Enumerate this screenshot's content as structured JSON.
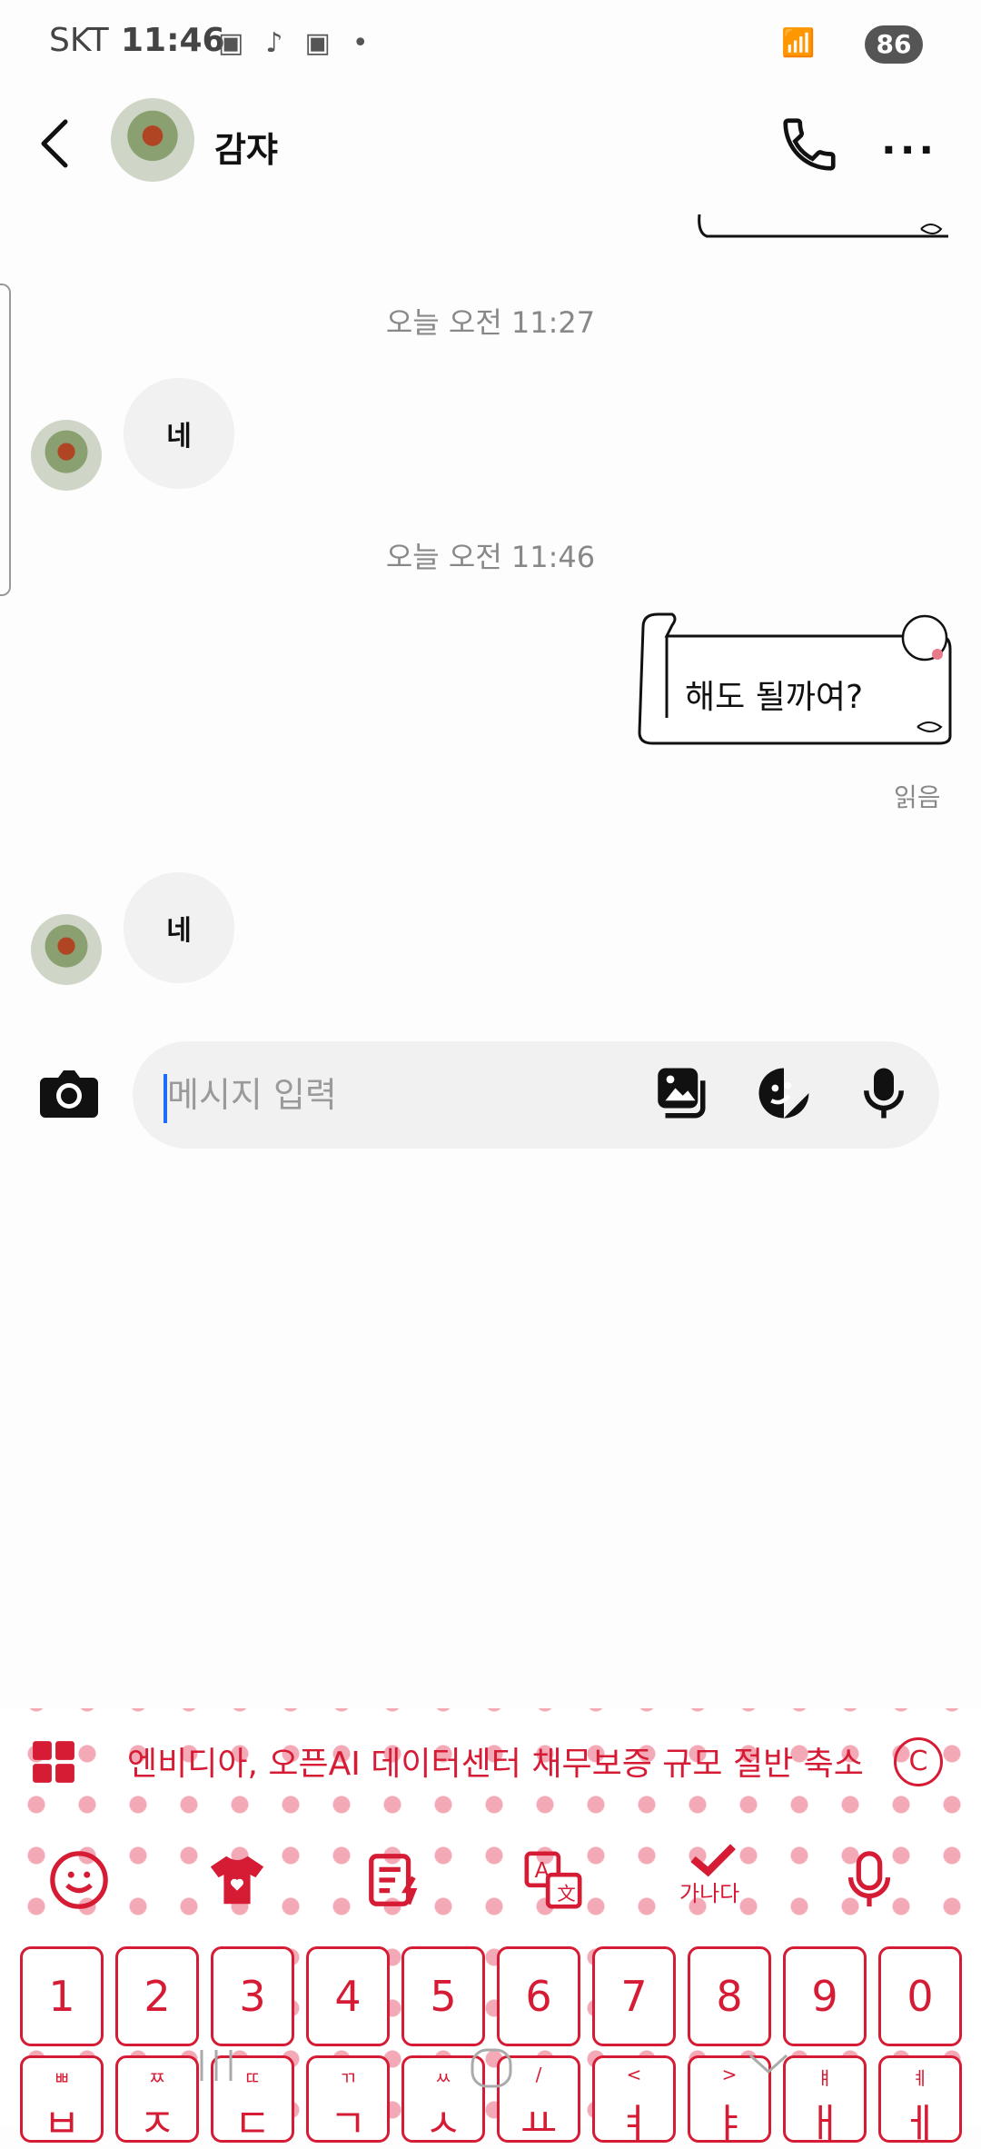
{
  "status_bar": {
    "carrier": "SKT",
    "time": "11:46",
    "battery": "86"
  },
  "header": {
    "title": "감쟈"
  },
  "messages": {
    "timestamp_1": "오늘 오전 11:27",
    "msg_1": "네",
    "timestamp_2": "오늘 오전 11:46",
    "sticker_text": "해도 될까여?",
    "read_label": "읽음",
    "msg_2": "네"
  },
  "input": {
    "placeholder": "메시지 입력"
  },
  "keyboard": {
    "news_ticker": "엔비디아, 오픈AI 데이터센터 채무보증 규모 절반 축소",
    "copyright_symbol": "C",
    "check_label": "가나다",
    "number_keys": [
      "1",
      "2",
      "3",
      "4",
      "5",
      "6",
      "7",
      "8",
      "9",
      "0"
    ],
    "row2_keys": [
      {
        "main": "ㅂ",
        "sub": "ㅃ"
      },
      {
        "main": "ㅈ",
        "sub": "ㅉ"
      },
      {
        "main": "ㄷ",
        "sub": "ㄸ"
      },
      {
        "main": "ㄱ",
        "sub": "ㄲ"
      },
      {
        "main": "ㅅ",
        "sub": "ㅆ"
      },
      {
        "main": "ㅛ",
        "sub": "/"
      },
      {
        "main": "ㅕ",
        "sub": "<"
      },
      {
        "main": "ㅑ",
        "sub": ">"
      },
      {
        "main": "ㅐ",
        "sub": "ㅒ"
      },
      {
        "main": "ㅔ",
        "sub": "ㅖ"
      }
    ]
  }
}
